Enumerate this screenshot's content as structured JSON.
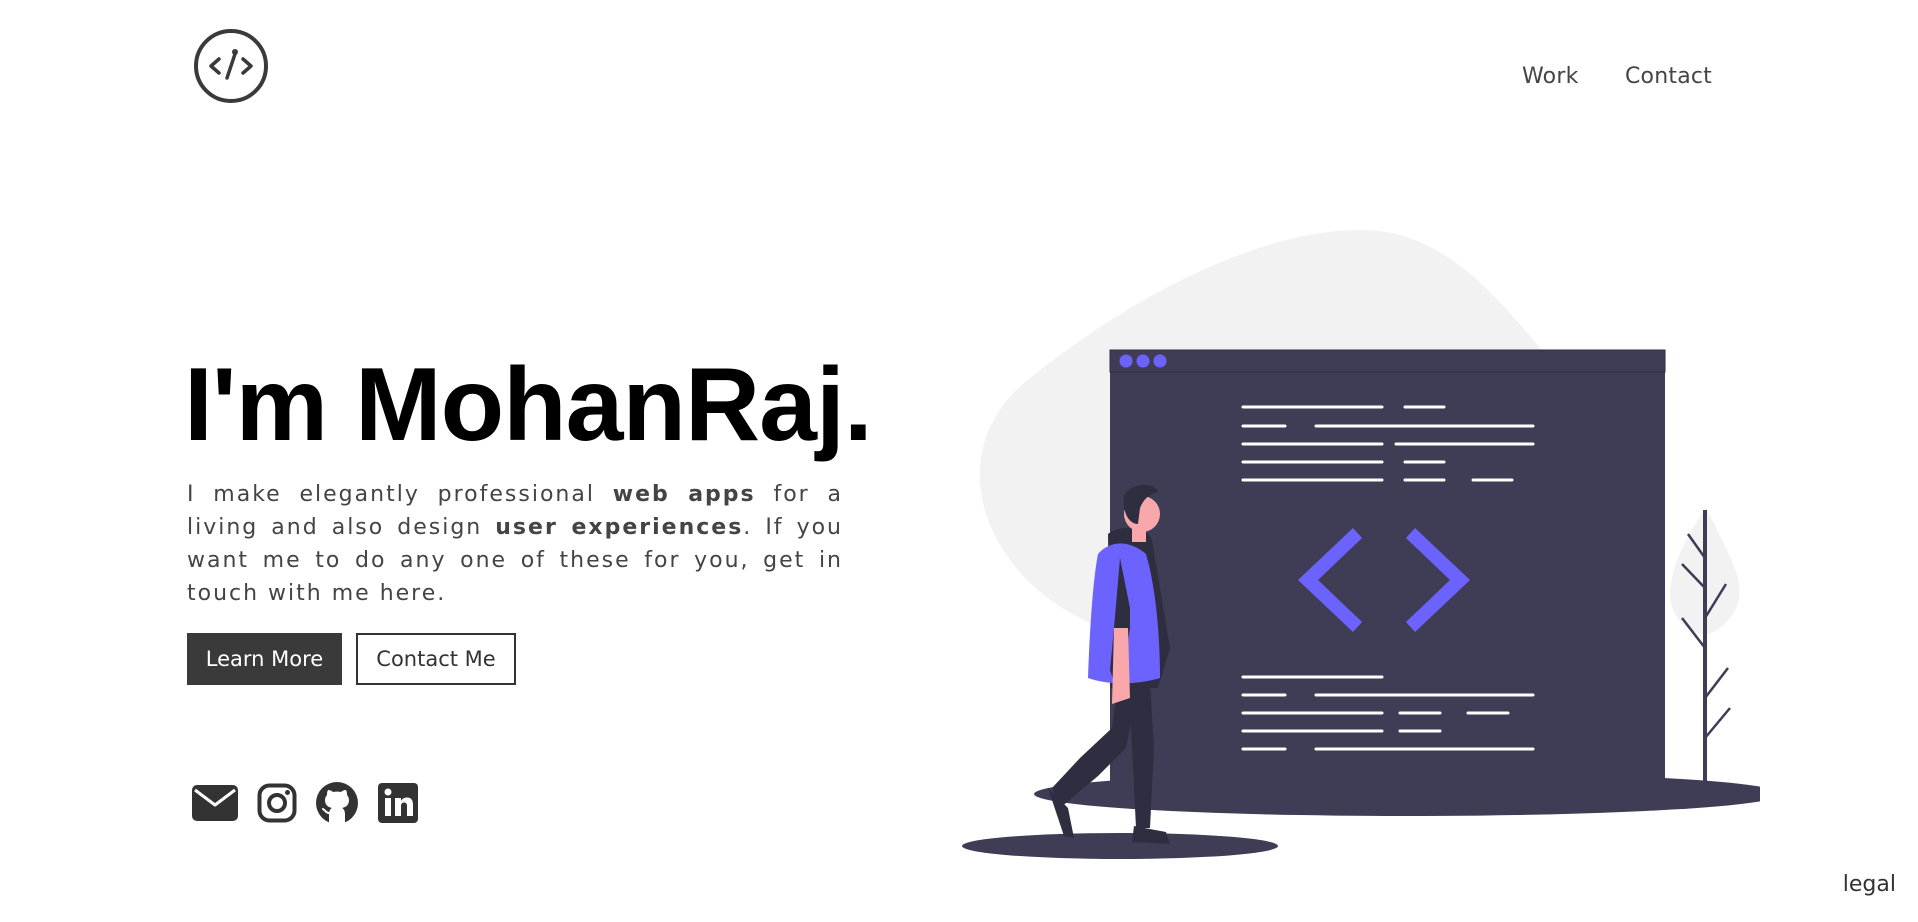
{
  "nav": {
    "items": [
      "Work",
      "Contact"
    ]
  },
  "hero": {
    "title": "I'm MohanRaj.",
    "intro_1": "I make elegantly professional ",
    "intro_bold_1": "web apps",
    "intro_2": " for a living and also design ",
    "intro_bold_2": "user experiences",
    "intro_3": ". If you want me to do any one of these for you, get in touch with me here."
  },
  "buttons": {
    "learn_more": "Learn More",
    "contact_me": "Contact Me"
  },
  "socials": [
    "mail-icon",
    "instagram-icon",
    "github-icon",
    "linkedin-icon"
  ],
  "footer": {
    "legal": "legal"
  },
  "colors": {
    "accent": "#6c63ff",
    "dark": "#3f3d56",
    "blob": "#f2f2f2",
    "button_dark": "#3a3a3a"
  }
}
